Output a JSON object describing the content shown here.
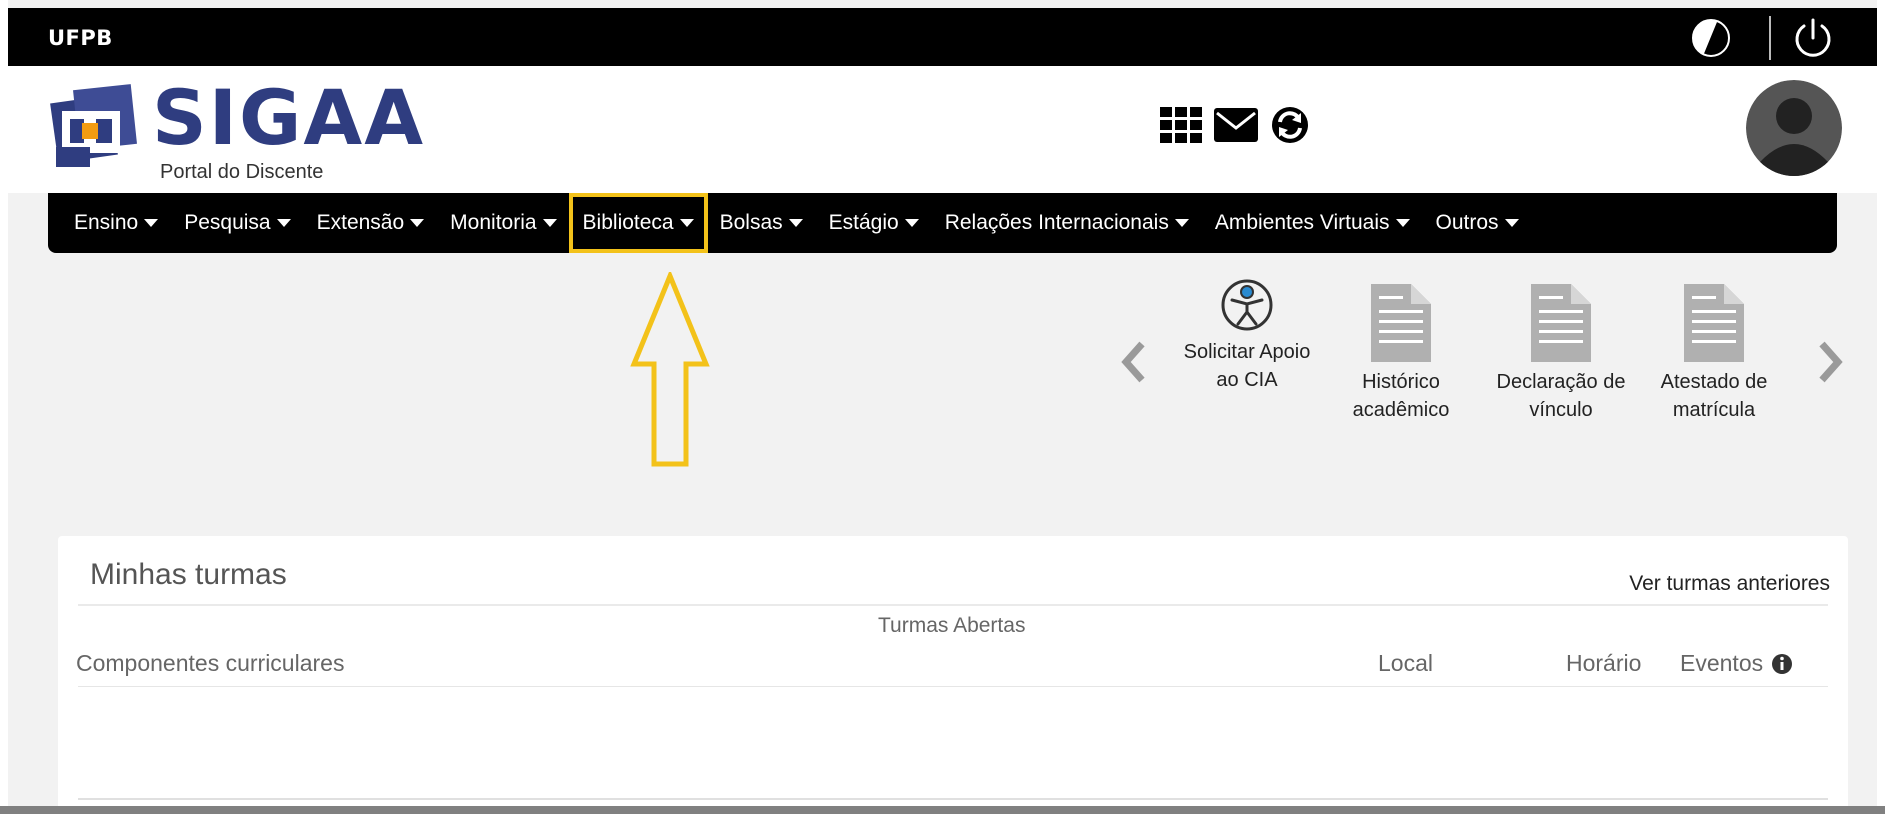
{
  "topbar": {
    "org": "UFPB",
    "contrast_icon": "contrast-icon",
    "power_icon": "power-icon"
  },
  "header": {
    "logo_text": "SIGAA",
    "portal_label": "Portal do Discente",
    "tools": [
      "apps-grid-icon",
      "mail-icon",
      "sync-icon"
    ],
    "avatar_icon": "user-avatar-icon"
  },
  "menu": {
    "items": [
      {
        "label": "Ensino"
      },
      {
        "label": "Pesquisa"
      },
      {
        "label": "Extensão"
      },
      {
        "label": "Monitoria"
      },
      {
        "label": "Biblioteca",
        "highlighted": true
      },
      {
        "label": "Bolsas"
      },
      {
        "label": "Estágio"
      },
      {
        "label": "Relações Internacionais"
      },
      {
        "label": "Ambientes Virtuais"
      },
      {
        "label": "Outros"
      }
    ]
  },
  "annotation": {
    "arrow_color": "#f3c21a",
    "highlight_color": "#f3c21a"
  },
  "quick_access": {
    "items": [
      {
        "line1": "Solicitar Apoio",
        "line2": "ao CIA",
        "icon": "accessibility-icon"
      },
      {
        "line1": "Histórico",
        "line2": "acadêmico",
        "icon": "document-icon"
      },
      {
        "line1": "Declaração de",
        "line2": "vínculo",
        "icon": "document-icon"
      },
      {
        "line1": "Atestado de",
        "line2": "matrícula",
        "icon": "document-icon"
      }
    ]
  },
  "turmas": {
    "title": "Minhas turmas",
    "previous_link": "Ver turmas anteriores",
    "open_label": "Turmas Abertas",
    "columns": {
      "components": "Componentes curriculares",
      "local": "Local",
      "horario": "Horário",
      "eventos": "Eventos"
    }
  },
  "colors": {
    "brand_blue": "#2f3d80",
    "accent_orange": "#f39c12",
    "highlight_yellow": "#f3c21a"
  }
}
